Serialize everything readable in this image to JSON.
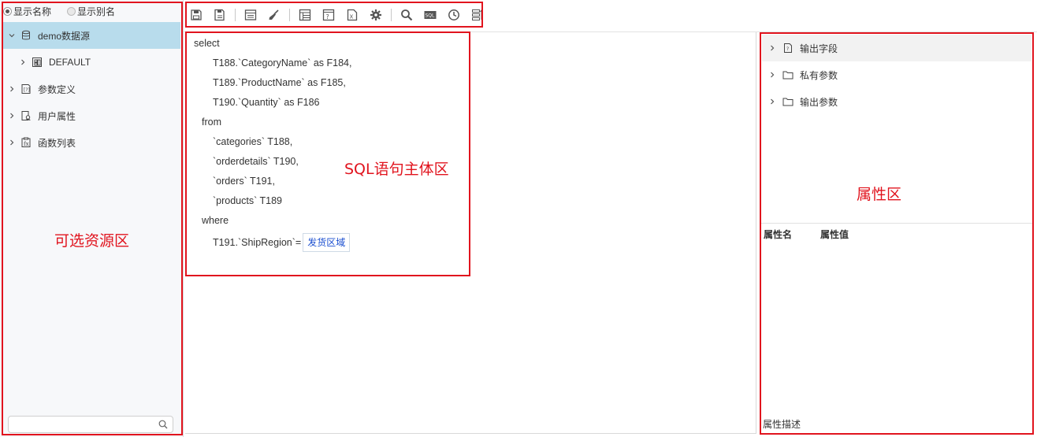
{
  "left": {
    "radio_name": "显示名称",
    "radio_alias": "显示别名",
    "tree": [
      {
        "label": "demo数据源",
        "icon": "database-icon",
        "expanded": true,
        "selected": true
      },
      {
        "label": "DEFAULT",
        "icon": "schema-icon",
        "expanded": false
      },
      {
        "label": "参数定义",
        "icon": "parameter-icon",
        "expanded": false
      },
      {
        "label": "用户属性",
        "icon": "user-attribute-icon",
        "expanded": false
      },
      {
        "label": "函数列表",
        "icon": "function-icon",
        "expanded": false
      }
    ],
    "search_placeholder": "",
    "annotation": "可选资源区"
  },
  "toolbar": {
    "buttons": [
      "save-icon",
      "save-as-icon",
      "layout-icon",
      "clear-icon",
      "table-icon",
      "param-icon",
      "export-icon",
      "settings-icon",
      "search-icon",
      "sql-icon",
      "history-icon",
      "format-icon"
    ]
  },
  "sql": {
    "lines": [
      "select",
      "T188.`CategoryName` as F184,",
      "T189.`ProductName` as F185,",
      "T190.`Quantity` as F186",
      "from",
      "`categories` T188,",
      "`orderdetails` T190,",
      "`orders` T191,",
      "`products` T189",
      "where",
      "T191.`ShipRegion`="
    ],
    "param": "发货区域",
    "annotation": "SQL语句主体区"
  },
  "right": {
    "tree": [
      {
        "label": "输出字段",
        "icon": "output-field-icon"
      },
      {
        "label": "私有参数",
        "icon": "folder-icon"
      },
      {
        "label": "输出参数",
        "icon": "folder-icon"
      }
    ],
    "annotation": "属性区",
    "prop_name": "属性名",
    "prop_value": "属性值",
    "prop_desc": "属性描述"
  },
  "colors": {
    "annotation": "#e1141e",
    "selected": "#b8dcec",
    "param": "#1b4fd0"
  }
}
